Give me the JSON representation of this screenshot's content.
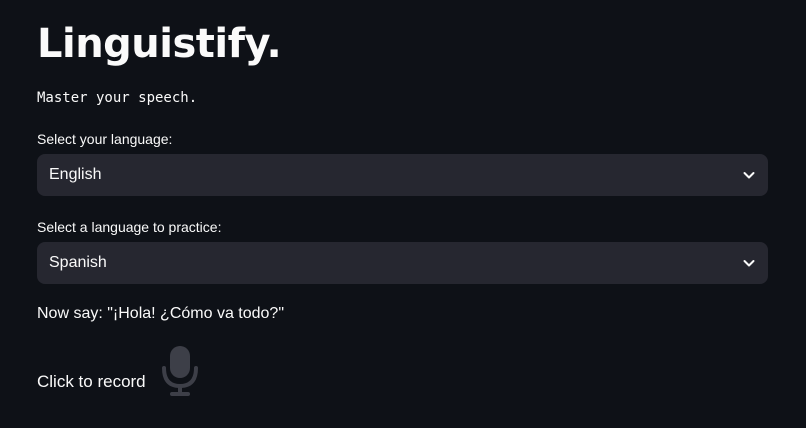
{
  "app": {
    "title": "Linguistify.",
    "subtitle": "Master your speech."
  },
  "native_language": {
    "label": "Select your language:",
    "selected": "English"
  },
  "practice_language": {
    "label": "Select a language to practice:",
    "selected": "Spanish"
  },
  "prompt": {
    "text": "Now say: \"¡Hola! ¿Cómo va todo?\""
  },
  "recorder": {
    "label": "Click to record",
    "icon": "microphone-icon"
  },
  "colors": {
    "background": "#0e1117",
    "text": "#fafafa",
    "select_background": "#262730",
    "mic_icon": "#3d3f48"
  }
}
